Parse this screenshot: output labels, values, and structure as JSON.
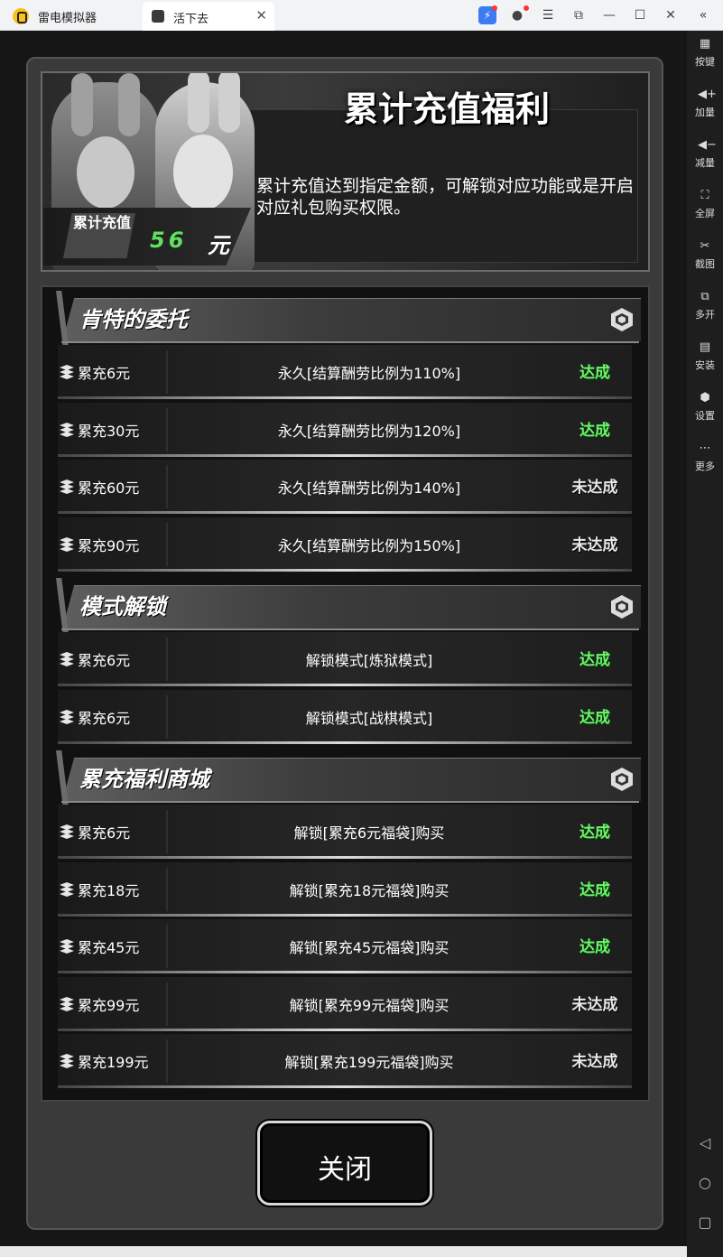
{
  "titlebar": {
    "app_name": "雷电模拟器",
    "tab_label": "活下去",
    "tab_close": "✕",
    "icons": [
      "bolt-icon",
      "user-icon",
      "menu-icon",
      "popout-icon",
      "minimize-icon",
      "maximize-icon",
      "close-icon",
      "collapse-icon"
    ]
  },
  "sidebar": {
    "items": [
      {
        "label": "按键",
        "icon": "keyboard-icon"
      },
      {
        "label": "加量",
        "icon": "volume-up-icon"
      },
      {
        "label": "减量",
        "icon": "volume-down-icon"
      },
      {
        "label": "全屏",
        "icon": "fullscreen-icon"
      },
      {
        "label": "截图",
        "icon": "scissors-icon"
      },
      {
        "label": "多开",
        "icon": "multi-instance-icon"
      },
      {
        "label": "安装",
        "icon": "apk-icon"
      },
      {
        "label": "设置",
        "icon": "gear-icon"
      },
      {
        "label": "更多",
        "icon": "more-icon"
      }
    ],
    "nav": [
      "◁",
      "○",
      "▢"
    ]
  },
  "banner": {
    "title": "累计充值福利",
    "description": "累计充值达到指定金额，可解锁对应功能或是开启对应礼包购买权限。",
    "total_label": "累计充值",
    "total_value": "56",
    "total_unit": "元"
  },
  "sections": [
    {
      "title": "肯特的委托",
      "rows": [
        {
          "condition": "累充6元",
          "reward": "永久[结算酬劳比例为110%]",
          "status": "达成",
          "done": true
        },
        {
          "condition": "累充30元",
          "reward": "永久[结算酬劳比例为120%]",
          "status": "达成",
          "done": true
        },
        {
          "condition": "累充60元",
          "reward": "永久[结算酬劳比例为140%]",
          "status": "未达成",
          "done": false
        },
        {
          "condition": "累充90元",
          "reward": "永久[结算酬劳比例为150%]",
          "status": "未达成",
          "done": false
        }
      ]
    },
    {
      "title": "模式解锁",
      "rows": [
        {
          "condition": "累充6元",
          "reward": "解锁模式[炼狱模式]",
          "status": "达成",
          "done": true
        },
        {
          "condition": "累充6元",
          "reward": "解锁模式[战棋模式]",
          "status": "达成",
          "done": true
        }
      ]
    },
    {
      "title": "累充福利商城",
      "rows": [
        {
          "condition": "累充6元",
          "reward": "解锁[累充6元福袋]购买",
          "status": "达成",
          "done": true
        },
        {
          "condition": "累充18元",
          "reward": "解锁[累充18元福袋]购买",
          "status": "达成",
          "done": true
        },
        {
          "condition": "累充45元",
          "reward": "解锁[累充45元福袋]购买",
          "status": "达成",
          "done": true
        },
        {
          "condition": "累充99元",
          "reward": "解锁[累充99元福袋]购买",
          "status": "未达成",
          "done": false
        },
        {
          "condition": "累充199元",
          "reward": "解锁[累充199元福袋]购买",
          "status": "未达成",
          "done": false
        }
      ]
    }
  ],
  "close_button": {
    "label": "关闭"
  },
  "colors": {
    "done": "#6cf56c",
    "not_done": "#e8e8e8",
    "panel": "#3a3a3a"
  }
}
